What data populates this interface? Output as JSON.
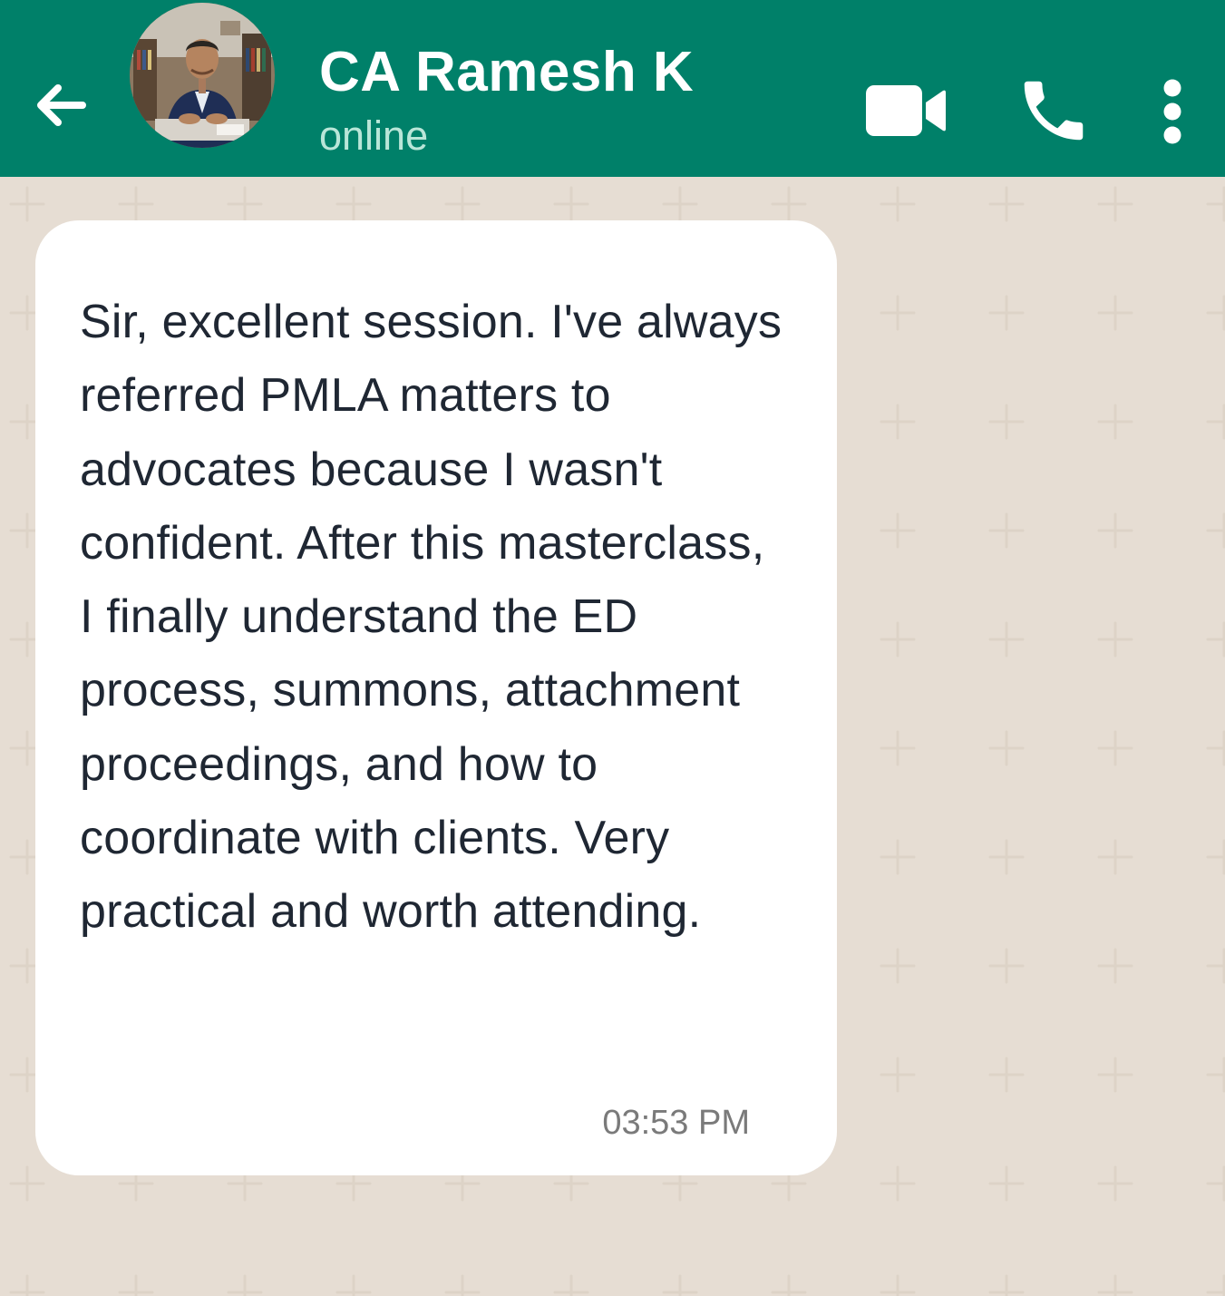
{
  "header": {
    "contact_name": "CA Ramesh K",
    "status": "online",
    "back_icon": "arrow-left-icon",
    "video_icon": "video-camera-icon",
    "call_icon": "phone-icon",
    "menu_icon": "more-vertical-icon",
    "background_color": "#008069"
  },
  "chat": {
    "background_color": "#e6ddd3",
    "messages": [
      {
        "direction": "incoming",
        "text": "Sir, excellent session. I've always referred PMLA matters to advocates because I wasn't confident. After this masterclass, I finally understand the ED process, summons, attachment proceedings, and how to coordinate with clients. Very practical and worth attending.",
        "time": "03:53 PM"
      }
    ]
  }
}
